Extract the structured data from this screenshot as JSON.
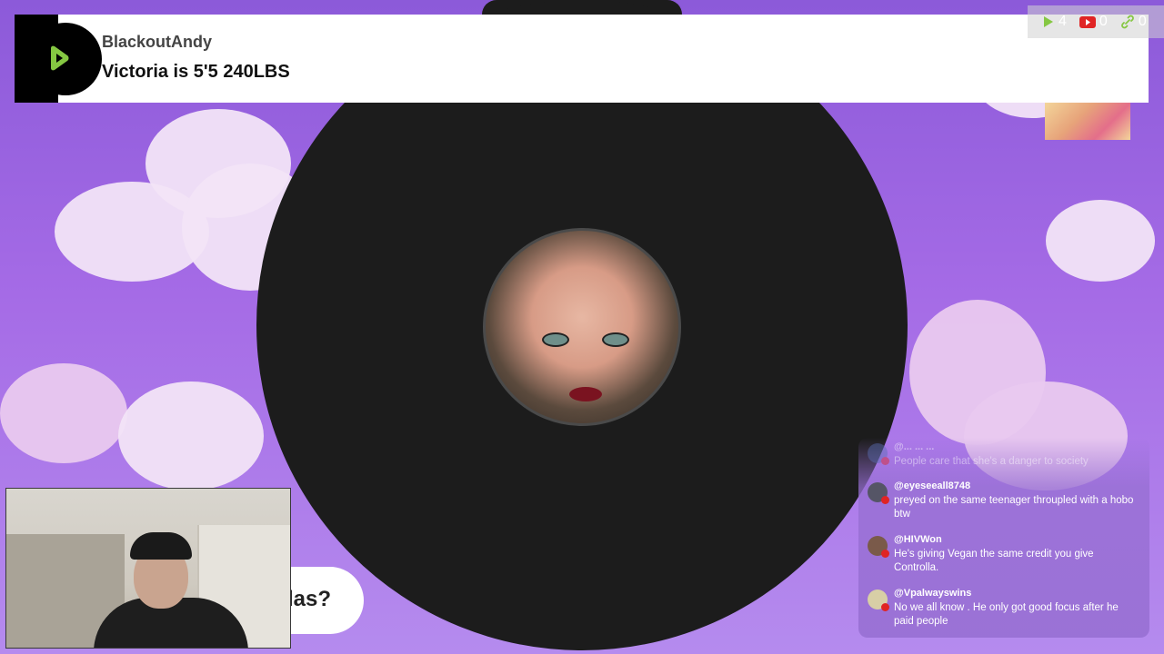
{
  "banner": {
    "username": "BlackoutAndy",
    "message": "Victoria is 5'5 240LBS"
  },
  "counters": {
    "rumble": "4",
    "youtube": "0",
    "links": "0"
  },
  "bubble": {
    "text": "las?"
  },
  "chat": {
    "messages": [
      {
        "user": "@... ... ...",
        "text": "People care that she's a danger to society",
        "faded": true
      },
      {
        "user": "@eyeseeall8748",
        "text": "preyed on the same teenager throupled with a hobo btw"
      },
      {
        "user": "@HIVWon",
        "text": "He's giving Vegan the same credit you give Controlla."
      },
      {
        "user": "@Vpalwayswins",
        "text": "No we all know . He only got good focus after he paid people"
      }
    ]
  },
  "colors": {
    "rumble_green": "#85c742",
    "youtube_red": "#e02424",
    "background_purple": "#a56be6"
  }
}
